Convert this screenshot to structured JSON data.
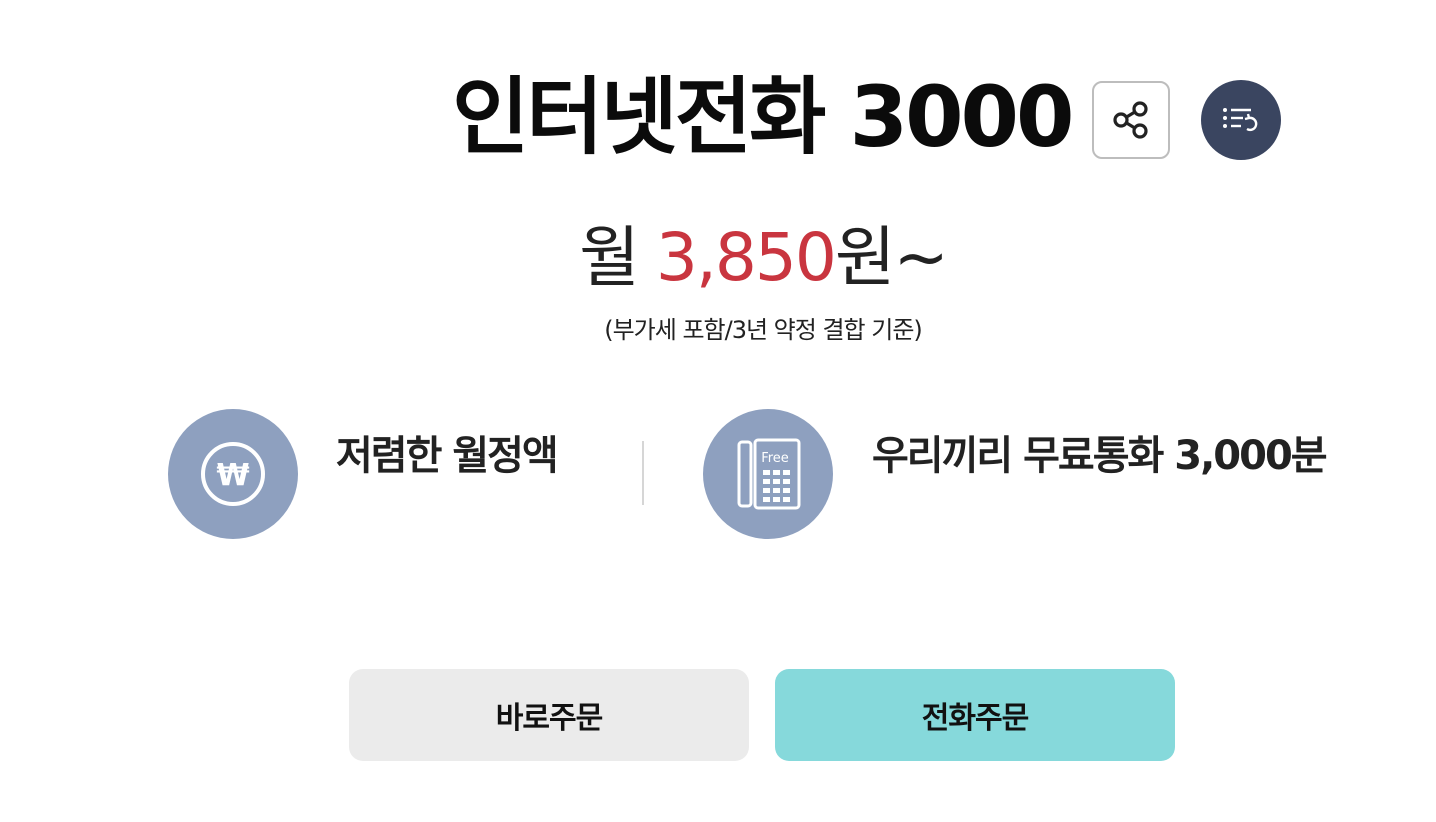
{
  "product": {
    "title": "인터넷전화 3000"
  },
  "header_actions": {
    "share_icon": "share-icon",
    "list_icon": "list-return-icon",
    "list_button_color": "#3a4560"
  },
  "price": {
    "prefix": "월",
    "amount": "3,850",
    "suffix": "원~",
    "amount_color": "#c9353f",
    "note": "(부가세 포함/3년 약정 결합 기준)"
  },
  "features": [
    {
      "icon": "won-coin-icon",
      "label": "저렴한 월정액"
    },
    {
      "icon": "free-phone-icon",
      "label": "우리끼리 무료통화 3,000분"
    }
  ],
  "feature_icon_color": "#8ea0bf",
  "buttons": {
    "direct_order": "바로주문",
    "phone_order": "전화주문",
    "phone_order_color": "#86d9db"
  }
}
